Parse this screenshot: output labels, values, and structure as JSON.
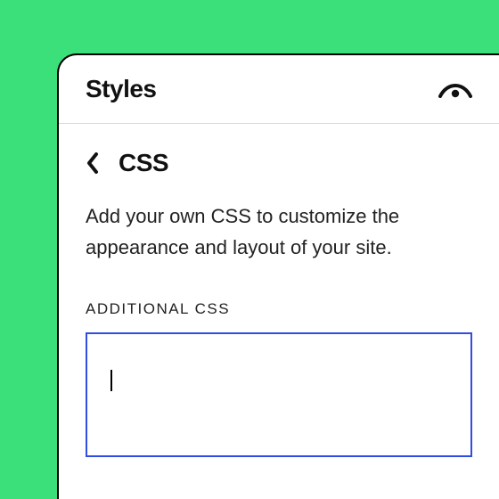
{
  "header": {
    "title": "Styles"
  },
  "breadcrumb": {
    "title": "CSS"
  },
  "description": "Add your own CSS to customize the appearance and layout of your site.",
  "section": {
    "label": "ADDITIONAL CSS",
    "editor_value": ""
  }
}
